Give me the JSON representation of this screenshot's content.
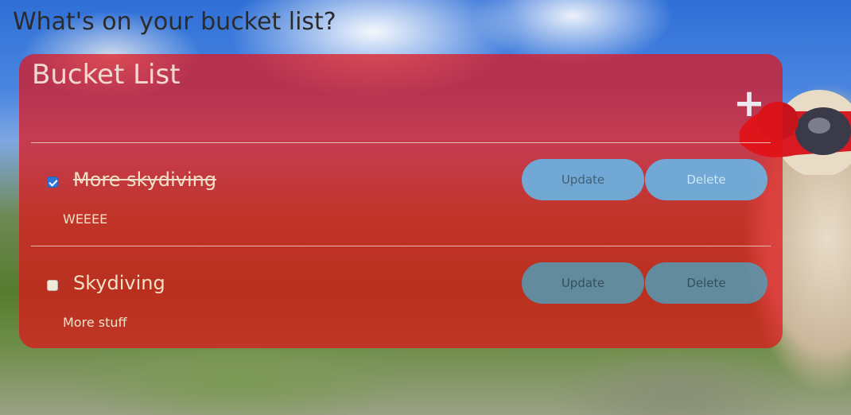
{
  "page": {
    "heading": "What's on your bucket list?"
  },
  "card": {
    "title": "Bucket List",
    "add_icon": "plus-icon",
    "add_glyph": "+"
  },
  "items": [
    {
      "title": "More skydiving",
      "description": "WEEEE",
      "completed": true,
      "update_label": "Update",
      "delete_label": "Delete"
    },
    {
      "title": "Skydiving",
      "description": "More stuff",
      "completed": false,
      "update_label": "Update",
      "delete_label": "Delete"
    }
  ],
  "colors": {
    "card_background": "#e11419",
    "button_done": "#5ac8ff",
    "button_open": "#46aac8",
    "text": "#efe0c8"
  }
}
